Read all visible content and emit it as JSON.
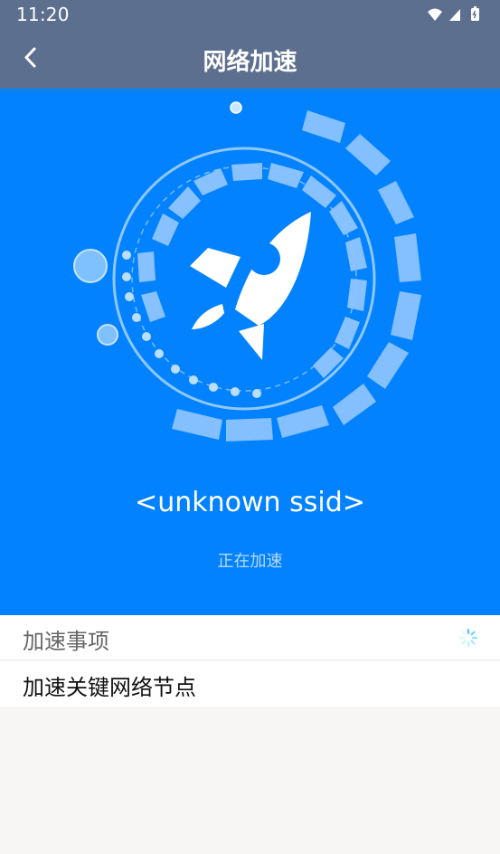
{
  "status_bar": {
    "time": "11:20",
    "icons": [
      "wifi-icon",
      "signal-icon",
      "battery-icon"
    ]
  },
  "header": {
    "title": "网络加速",
    "back_icon": "back-arrow-icon"
  },
  "hero": {
    "ssid": "<unknown ssid>",
    "status": "正在加速",
    "icon": "rocket-icon",
    "background_color": "#0382ff"
  },
  "list": {
    "section_title": "加速事项",
    "loading_icon": "loading-spinner-icon",
    "items": [
      {
        "label": "加速关键网络节点"
      }
    ]
  }
}
